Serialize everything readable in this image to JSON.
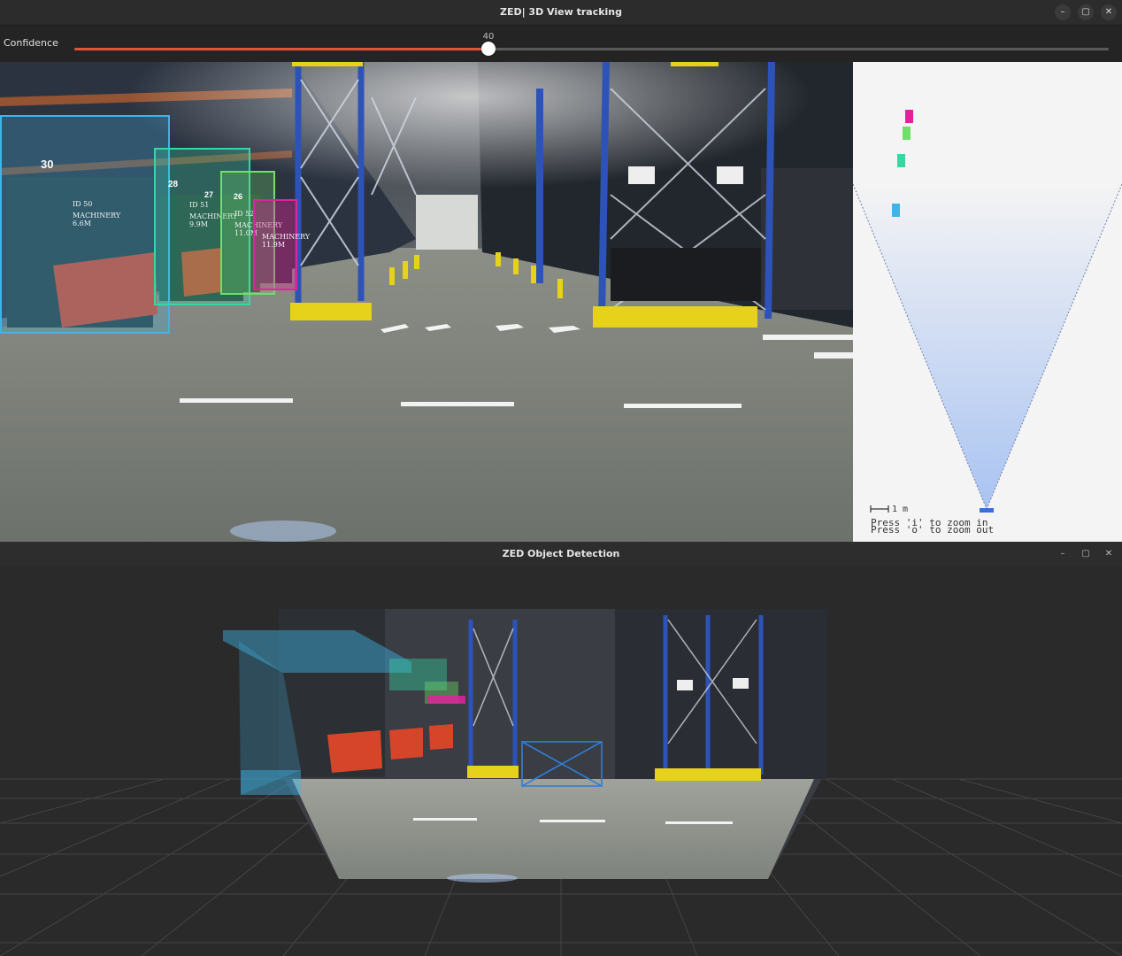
{
  "top_window": {
    "title": "ZED| 3D View tracking",
    "controls": [
      "–",
      "▢",
      "✕"
    ]
  },
  "toolbar": {
    "confidence_label": "Confidence",
    "confidence_value": "40",
    "confidence_fraction": 0.4,
    "slider_color": "#e2533a"
  },
  "detections": [
    {
      "id_label": "ID 50",
      "class_label": "MACHINERY",
      "distance": "6.6M",
      "track_num": "30",
      "color": "#3fb4e6"
    },
    {
      "id_label": "ID 51",
      "class_label": "MACHINERY",
      "distance": "9.9M",
      "track_num": "28",
      "color": "#35d7a4"
    },
    {
      "id_label": "ID 52",
      "class_label": "MACHINERY",
      "distance": "11.0M",
      "track_num": "27",
      "color": "#6fdf6a"
    },
    {
      "id_label": "",
      "class_label": "MACHINERY",
      "distance": "11.9M",
      "track_num": "26",
      "color": "#e0239b"
    }
  ],
  "birdseye": {
    "scale_label": "1 m",
    "zoom_in_hint": "Press 'i' to zoom in",
    "zoom_out_hint": "Press 'o' to zoom out",
    "fov_color": "#a9c3f2",
    "camera_color": "#3a6fd8"
  },
  "bottom_window": {
    "title": "ZED Object Detection",
    "controls": [
      "–",
      "▢",
      "✕"
    ]
  }
}
